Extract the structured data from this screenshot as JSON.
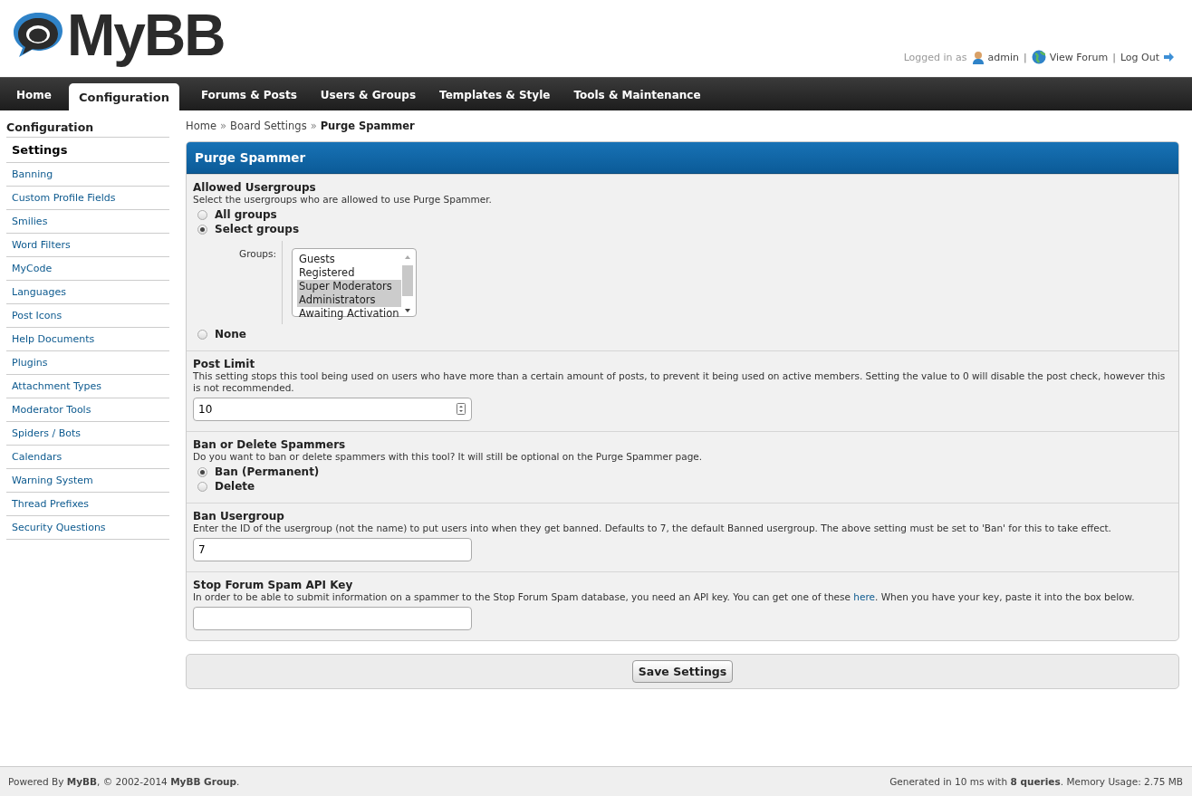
{
  "header": {
    "logo_text": "MyBB",
    "logged_in_prefix": "Logged in as",
    "username": "admin",
    "view_forum": "View Forum",
    "logout": "Log Out",
    "separator": "|"
  },
  "nav": [
    {
      "label": "Home",
      "selected": false
    },
    {
      "label": "Configuration",
      "selected": true
    },
    {
      "label": "Forums & Posts",
      "selected": false
    },
    {
      "label": "Users & Groups",
      "selected": false
    },
    {
      "label": "Templates & Style",
      "selected": false
    },
    {
      "label": "Tools & Maintenance",
      "selected": false
    }
  ],
  "sidebar": {
    "title": "Configuration",
    "items": [
      {
        "label": "Settings",
        "selected": true
      },
      {
        "label": "Banning",
        "selected": false
      },
      {
        "label": "Custom Profile Fields",
        "selected": false
      },
      {
        "label": "Smilies",
        "selected": false
      },
      {
        "label": "Word Filters",
        "selected": false
      },
      {
        "label": "MyCode",
        "selected": false
      },
      {
        "label": "Languages",
        "selected": false
      },
      {
        "label": "Post Icons",
        "selected": false
      },
      {
        "label": "Help Documents",
        "selected": false
      },
      {
        "label": "Plugins",
        "selected": false
      },
      {
        "label": "Attachment Types",
        "selected": false
      },
      {
        "label": "Moderator Tools",
        "selected": false
      },
      {
        "label": "Spiders / Bots",
        "selected": false
      },
      {
        "label": "Calendars",
        "selected": false
      },
      {
        "label": "Warning System",
        "selected": false
      },
      {
        "label": "Thread Prefixes",
        "selected": false
      },
      {
        "label": "Security Questions",
        "selected": false
      }
    ]
  },
  "breadcrumb": {
    "separator": "»",
    "items": [
      "Home",
      "Board Settings",
      "Purge Spammer"
    ]
  },
  "panel": {
    "title": "Purge Spammer",
    "settings": [
      {
        "kind": "radio",
        "title": "Allowed Usergroups",
        "description": [
          {
            "text": "Select the usergroups who are allowed to use Purge Spammer."
          }
        ],
        "options": [
          {
            "label": "All groups",
            "selected": false
          },
          {
            "label": "Select groups",
            "selected": true,
            "groups": {
              "label": "Groups:",
              "options": [
                {
                  "label": "Guests",
                  "selected": false
                },
                {
                  "label": "Registered",
                  "selected": false
                },
                {
                  "label": "Super Moderators",
                  "selected": true
                },
                {
                  "label": "Administrators",
                  "selected": true
                },
                {
                  "label": "Awaiting Activation",
                  "selected": false
                }
              ]
            }
          },
          {
            "label": "None",
            "selected": false
          }
        ]
      },
      {
        "kind": "number",
        "title": "Post Limit",
        "description": [
          {
            "text": "This setting stops this tool being used on users who have more than a certain amount of posts, to prevent it being used on active members. Setting the value to 0 will disable the post check, however this is not recommended."
          }
        ],
        "value": "10"
      },
      {
        "kind": "radio",
        "title": "Ban or Delete Spammers",
        "description": [
          {
            "text": "Do you want to ban or delete spammers with this tool? It will still be optional on the Purge Spammer page."
          }
        ],
        "options": [
          {
            "label": "Ban (Permanent)",
            "selected": true
          },
          {
            "label": "Delete",
            "selected": false
          }
        ]
      },
      {
        "kind": "text",
        "title": "Ban Usergroup",
        "description": [
          {
            "text": "Enter the ID of the usergroup (not the name) to put users into when they get banned. Defaults to 7, the default Banned usergroup. The above setting must be set to 'Ban' for this to take effect."
          }
        ],
        "value": "7"
      },
      {
        "kind": "text",
        "title": "Stop Forum Spam API Key",
        "description": [
          {
            "text": "In order to be able to submit information on a spammer to the Stop Forum Spam database, you need an API key. You can get one of these "
          },
          {
            "text": "here",
            "link": true
          },
          {
            "text": ". When you have your key, paste it into the box below."
          }
        ]
      }
    ],
    "save_label": "Save Settings"
  },
  "footer": {
    "left": "Powered By **MyBB**, © 2002-2014 **MyBB Group**.",
    "right": "Generated in 10 ms with **8 queries**. Memory Usage: 2.75 MB"
  }
}
